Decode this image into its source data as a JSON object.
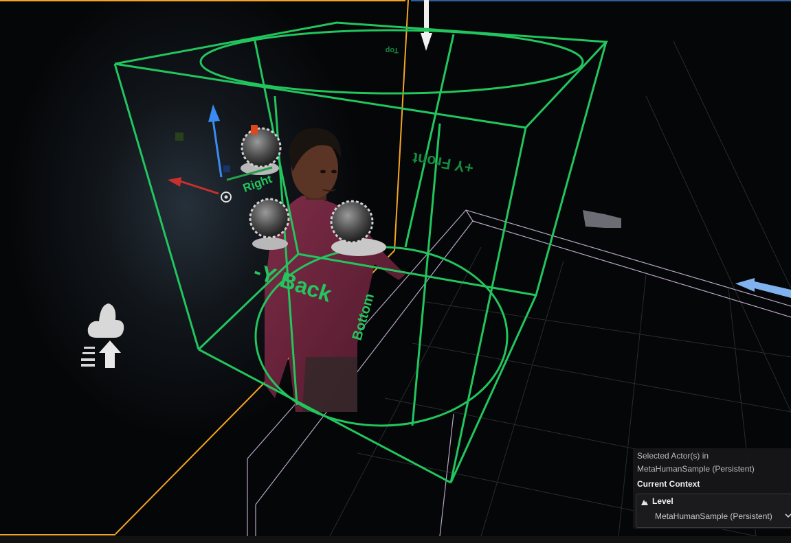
{
  "viewport": {
    "face_labels": {
      "back": "-Y Back",
      "front": "+Y Front",
      "bottom": "Bottom",
      "right": "Right",
      "top": "Top"
    }
  },
  "context_panel": {
    "heading": "Selected Actor(s) in",
    "world": "MetaHumanSample (Persistent)",
    "context_title": "Current Context",
    "level_label": "Level",
    "level_value": "MetaHumanSample (Persistent)",
    "level_icon": "level-icon",
    "dropdown_icon": "chevron-down-icon"
  },
  "colors": {
    "bounds_green": "#22c55e",
    "selection_orange": "#f5a524",
    "grid_lilac": "#b9a6c6",
    "gizmo_blue": "#3b8cf0",
    "gizmo_red": "#c9302c",
    "panel_bg": "#161618"
  }
}
